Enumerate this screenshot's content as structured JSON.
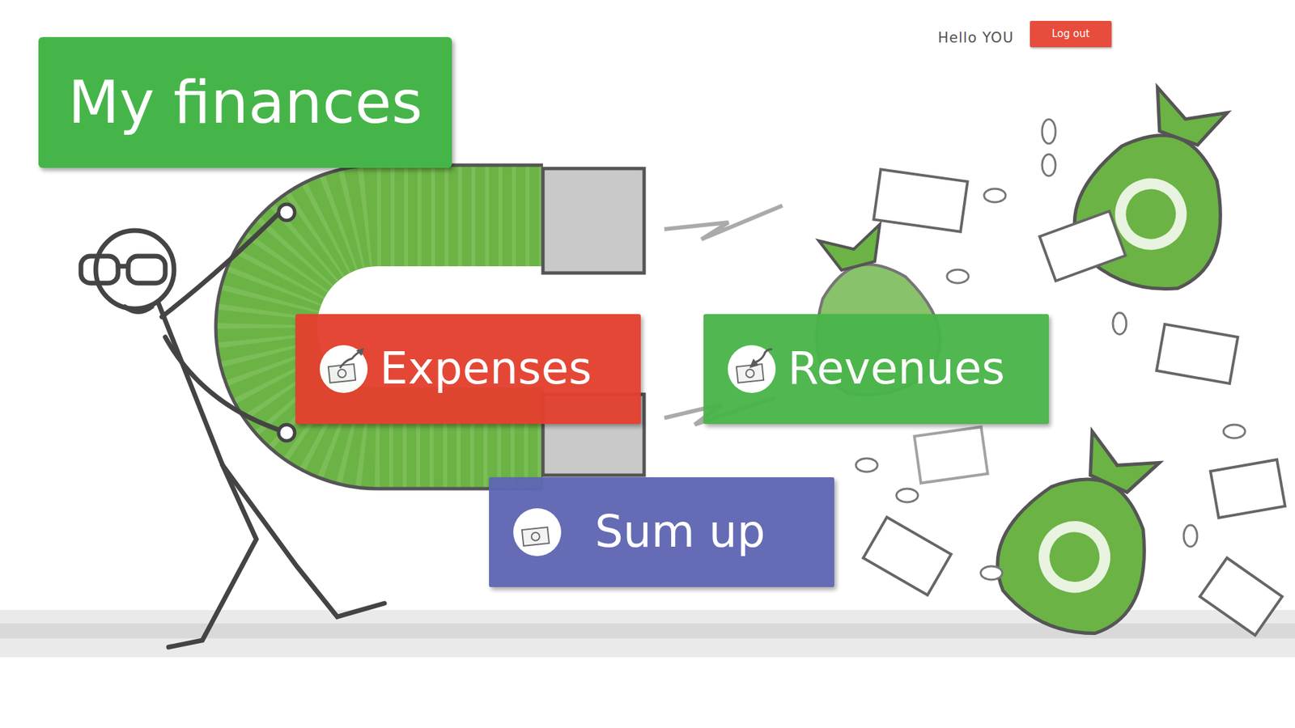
{
  "header": {
    "greeting": "Hello YOU",
    "logout": "Log out"
  },
  "title": "My finances",
  "tiles": [
    {
      "label": "Expenses",
      "kind": "expense",
      "color": "#e3402e"
    },
    {
      "label": "Revenues",
      "kind": "revenue",
      "color": "#4ab54a"
    },
    {
      "label": "Sum up",
      "kind": "summary",
      "color": "#5f67b3"
    }
  ]
}
